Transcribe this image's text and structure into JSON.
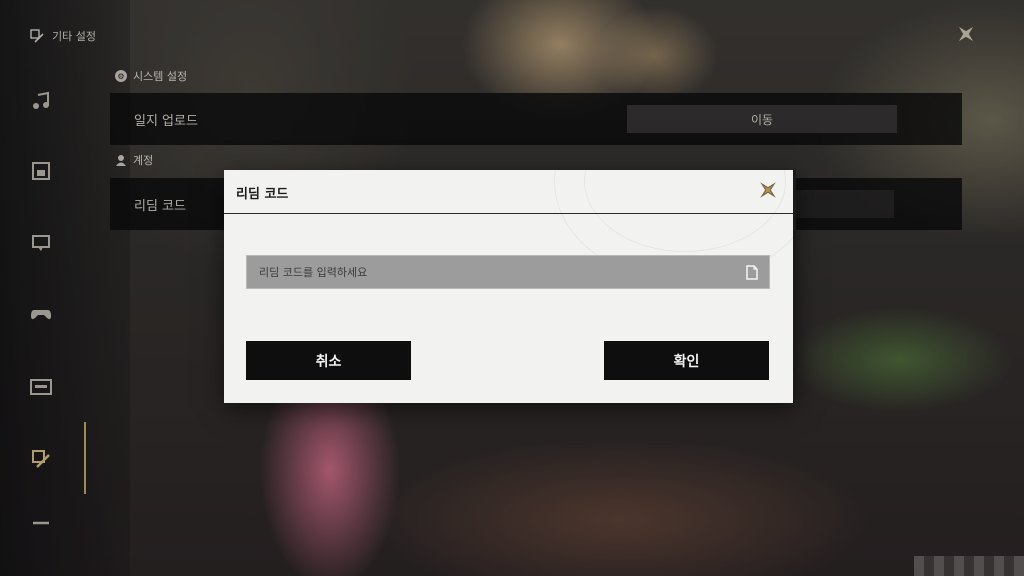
{
  "header": {
    "title": "기타 설정"
  },
  "sidebar": {
    "icons": [
      "music-icon",
      "display-icon",
      "chat-icon",
      "gamepad-icon",
      "keyboard-icon",
      "other-settings-icon",
      "minus-icon"
    ]
  },
  "settings": {
    "sections": [
      {
        "label": "시스템 설정",
        "rows": [
          {
            "label": "일지 업로드",
            "action": "이동"
          }
        ]
      },
      {
        "label": "계정",
        "rows": [
          {
            "label": "리딤 코드"
          }
        ]
      }
    ]
  },
  "dialog": {
    "title": "리딤 코드",
    "input": {
      "placeholder": "리딤 코드를 입력하세요",
      "value": ""
    },
    "cancel_label": "취소",
    "confirm_label": "확인"
  },
  "colors": {
    "accent_gold": "#c5a86a",
    "dialog_bg": "#f2f2f1",
    "button_bg": "#0e0e0e"
  }
}
